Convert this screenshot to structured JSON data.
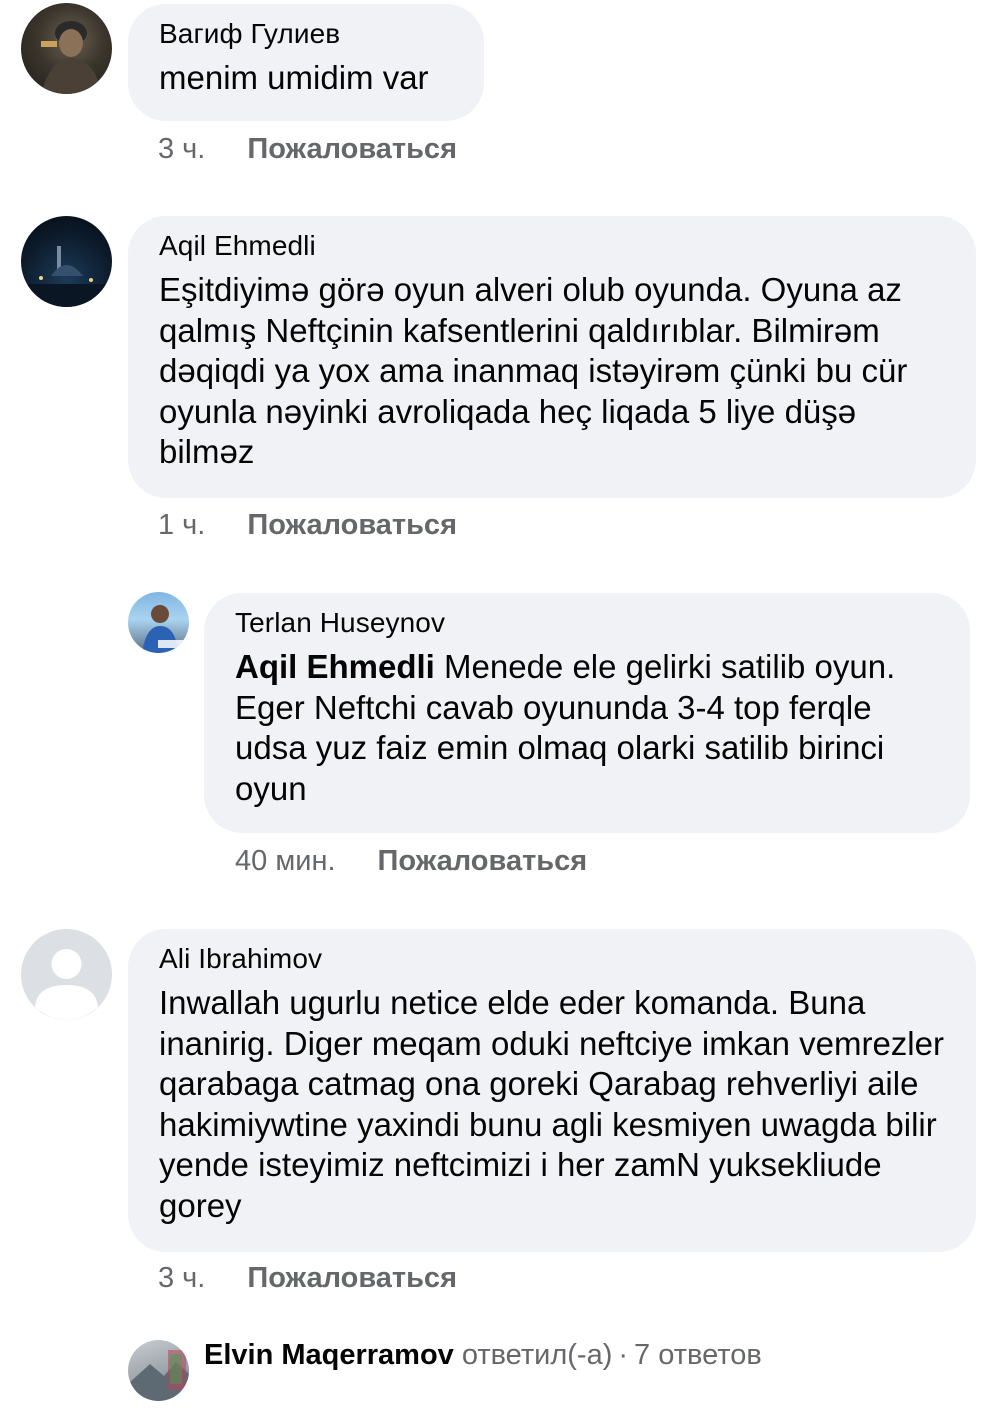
{
  "comments": [
    {
      "author": "Вагиф Гулиев",
      "text": "menim umidim var",
      "time": "3 ч.",
      "report_label": "Пожаловаться"
    },
    {
      "author": "Aqil Ehmedli",
      "text": "Eşitdiyimə görə oyun alveri olub oyunda. Oyuna az qalmış Neftçinin kafsentlerini qaldırıblar. Bilmirəm dəqiqdi ya yox ama inanmaq istəyirəm çünki bu cür oyunla nəyinki avroliqada heç liqada 5 liye düşə bilməz",
      "time": "1 ч.",
      "report_label": "Пожаловаться"
    },
    {
      "author": "Terlan Huseynov",
      "mention": "Aqil Ehmedli",
      "text": "Menede ele gelirki satilib oyun. Eger Neftchi cavab oyununda 3-4 top ferqle udsa yuz faiz emin olmaq olarki satilib birinci oyun",
      "time": "40 мин.",
      "report_label": "Пожаловаться"
    },
    {
      "author": "Ali Ibrahimov",
      "text": "Inwallah ugurlu netice elde eder komanda. Buna inanirig. Diger meqam oduki neftciye imkan vemrezler qarabaga catmag ona goreki Qarabag rehverliyi aile hakimiywtine yaxindi bunu agli kesmiyen uwagda bilir yende isteyimiz neftcimizi i her zamN yuksekliude gorey",
      "time": "3 ч.",
      "report_label": "Пожаловаться"
    }
  ],
  "replies_summary": {
    "name": "Elvin Maqerramov",
    "action": "ответил(-а)",
    "separator": "·",
    "count_label": "7 ответов"
  },
  "colors": {
    "bubble": "#f0f2f5",
    "meta_text": "#65676b",
    "text": "#050505"
  }
}
